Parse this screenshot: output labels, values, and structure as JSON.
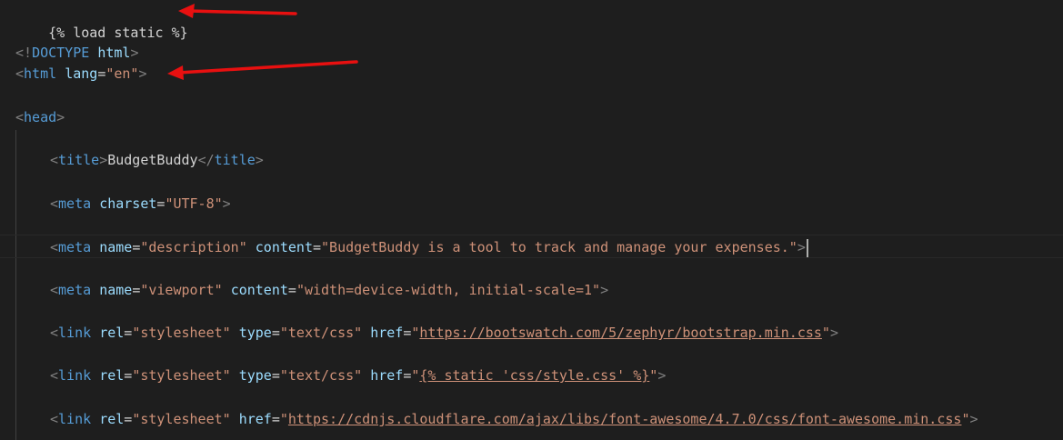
{
  "lines": {
    "load_static": "{% load static %}",
    "doctype": {
      "open": "<!",
      "keyword": "DOCTYPE",
      "value": "html",
      "close": ">"
    },
    "html": {
      "open": "<",
      "tag": "html",
      "attr": "lang",
      "value": "\"en\"",
      "close": ">"
    },
    "head": {
      "open": "<",
      "tag": "head",
      "close": ">"
    },
    "title": {
      "open": "<",
      "tag": "title",
      "close": ">",
      "text": "BudgetBuddy",
      "end_open": "</",
      "end_tag": "title",
      "end_close": ">"
    },
    "meta_charset": {
      "open": "<",
      "tag": "meta",
      "attr": "charset",
      "value": "\"UTF-8\"",
      "close": ">"
    },
    "meta_description": {
      "open": "<",
      "tag": "meta",
      "attr1": "name",
      "value1": "\"description\"",
      "attr2": "content",
      "value2": "\"BudgetBuddy is a tool to track and manage your expenses.\"",
      "close": ">"
    },
    "meta_viewport": {
      "open": "<",
      "tag": "meta",
      "attr1": "name",
      "value1": "\"viewport\"",
      "attr2": "content",
      "value2": "\"width=device-width, initial-scale=1\"",
      "close": ">"
    },
    "link_bootswatch": {
      "open": "<",
      "tag": "link",
      "attr1": "rel",
      "value1": "\"stylesheet\"",
      "attr2": "type",
      "value2": "\"text/css\"",
      "attr3": "href",
      "q1": "\"",
      "url": "https://bootswatch.com/5/zephyr/bootstrap.min.css",
      "q2": "\"",
      "close": ">"
    },
    "link_static": {
      "open": "<",
      "tag": "link",
      "attr1": "rel",
      "value1": "\"stylesheet\"",
      "attr2": "type",
      "value2": "\"text/css\"",
      "attr3": "href",
      "q1": "\"",
      "url": "{% static 'css/style.css' %}",
      "q2": "\"",
      "close": ">"
    },
    "link_fontawesome": {
      "open": "<",
      "tag": "link",
      "attr1": "rel",
      "value1": "\"stylesheet\"",
      "attr2": "href",
      "q1": "\"",
      "url": "https://cdnjs.cloudflare.com/ajax/libs/font-awesome/4.7.0/css/font-awesome.min.css",
      "q2": "\"",
      "close": ">"
    }
  },
  "colors": {
    "background": "#1e1e1e",
    "tag": "#569cd6",
    "attribute": "#9cdcfe",
    "string": "#ce9178",
    "bracket": "#808080",
    "text": "#d4d4d4",
    "annotation_arrow": "#e81010"
  }
}
